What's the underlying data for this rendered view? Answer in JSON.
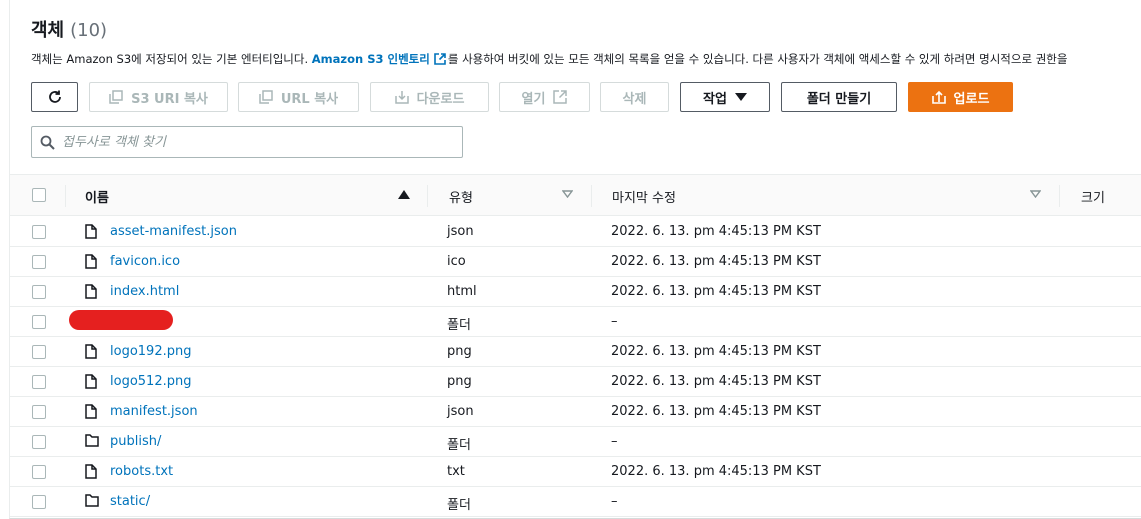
{
  "header": {
    "title": "객체",
    "count": "(10)"
  },
  "description": {
    "before": "객체는 Amazon S3에 저장되어 있는 기본 엔터티입니다. ",
    "link": "Amazon S3 인벤토리",
    "after": "를 사용하여 버킷에 있는 모든 객체의 목록을 얻을 수 있습니다. 다른 사용자가 객체에 액세스할 수 있게 하려면 명시적으로 권한을"
  },
  "toolbar": {
    "copy_s3_uri": "S3 URI 복사",
    "copy_url": "URL 복사",
    "download": "다운로드",
    "open": "열기",
    "delete": "삭제",
    "actions": "작업",
    "create_folder": "폴더 만들기",
    "upload": "업로드"
  },
  "search": {
    "placeholder": "접두사로 객체 찾기",
    "value": ""
  },
  "columns": {
    "name": "이름",
    "type": "유형",
    "modified": "마지막 수정",
    "size": "크기"
  },
  "rows": [
    {
      "name": "asset-manifest.json",
      "type": "json",
      "modified": "2022. 6. 13. pm 4:45:13 PM KST",
      "kind": "file"
    },
    {
      "name": "favicon.ico",
      "type": "ico",
      "modified": "2022. 6. 13. pm 4:45:13 PM KST",
      "kind": "file"
    },
    {
      "name": "index.html",
      "type": "html",
      "modified": "2022. 6. 13. pm 4:45:13 PM KST",
      "kind": "file"
    },
    {
      "name": "",
      "type": "폴더",
      "modified": "–",
      "kind": "redacted"
    },
    {
      "name": "logo192.png",
      "type": "png",
      "modified": "2022. 6. 13. pm 4:45:13 PM KST",
      "kind": "file"
    },
    {
      "name": "logo512.png",
      "type": "png",
      "modified": "2022. 6. 13. pm 4:45:13 PM KST",
      "kind": "file"
    },
    {
      "name": "manifest.json",
      "type": "json",
      "modified": "2022. 6. 13. pm 4:45:13 PM KST",
      "kind": "file"
    },
    {
      "name": "publish/",
      "type": "폴더",
      "modified": "–",
      "kind": "folder"
    },
    {
      "name": "robots.txt",
      "type": "txt",
      "modified": "2022. 6. 13. pm 4:45:13 PM KST",
      "kind": "file"
    },
    {
      "name": "static/",
      "type": "폴더",
      "modified": "–",
      "kind": "folder"
    }
  ],
  "colors": {
    "link": "#0073bb",
    "primary": "#ec7211",
    "redaction": "#e5201f"
  }
}
